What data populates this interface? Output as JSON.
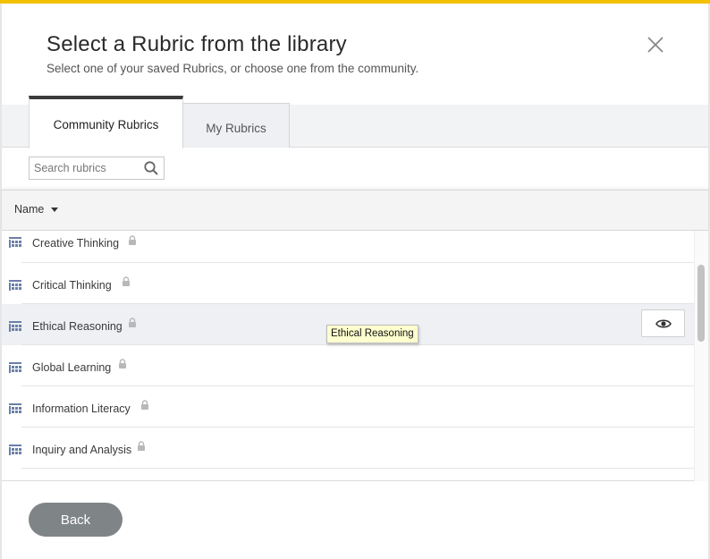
{
  "dialog": {
    "title": "Select a Rubric from the library",
    "subtitle": "Select one of your saved Rubrics, or choose one from the community."
  },
  "tabs": [
    {
      "label": "Community Rubrics",
      "active": true
    },
    {
      "label": "My Rubrics",
      "active": false
    }
  ],
  "search": {
    "placeholder": "Search rubrics",
    "value": ""
  },
  "list_header": {
    "sort_label": "Name"
  },
  "rubrics": [
    {
      "name": "Creative Thinking",
      "locked": true
    },
    {
      "name": "Critical Thinking",
      "locked": true
    },
    {
      "name": "Ethical Reasoning",
      "locked": true,
      "hovered": true
    },
    {
      "name": "Global Learning",
      "locked": true
    },
    {
      "name": "Information Literacy",
      "locked": true
    },
    {
      "name": "Inquiry and Analysis",
      "locked": true
    }
  ],
  "tooltip": {
    "text": "Ethical Reasoning"
  },
  "footer": {
    "back_label": "Back"
  },
  "colors": {
    "accent_bar": "#f2c200",
    "back_button": "#7f8487",
    "rubric_icon": "#6a7fa8",
    "lock_icon": "#b8b8b8"
  },
  "icons": {
    "close": "close-icon",
    "search": "search-icon",
    "sort": "caret-down-icon",
    "rubric": "rubric-grid-icon",
    "lock": "lock-icon",
    "preview": "eye-icon"
  }
}
